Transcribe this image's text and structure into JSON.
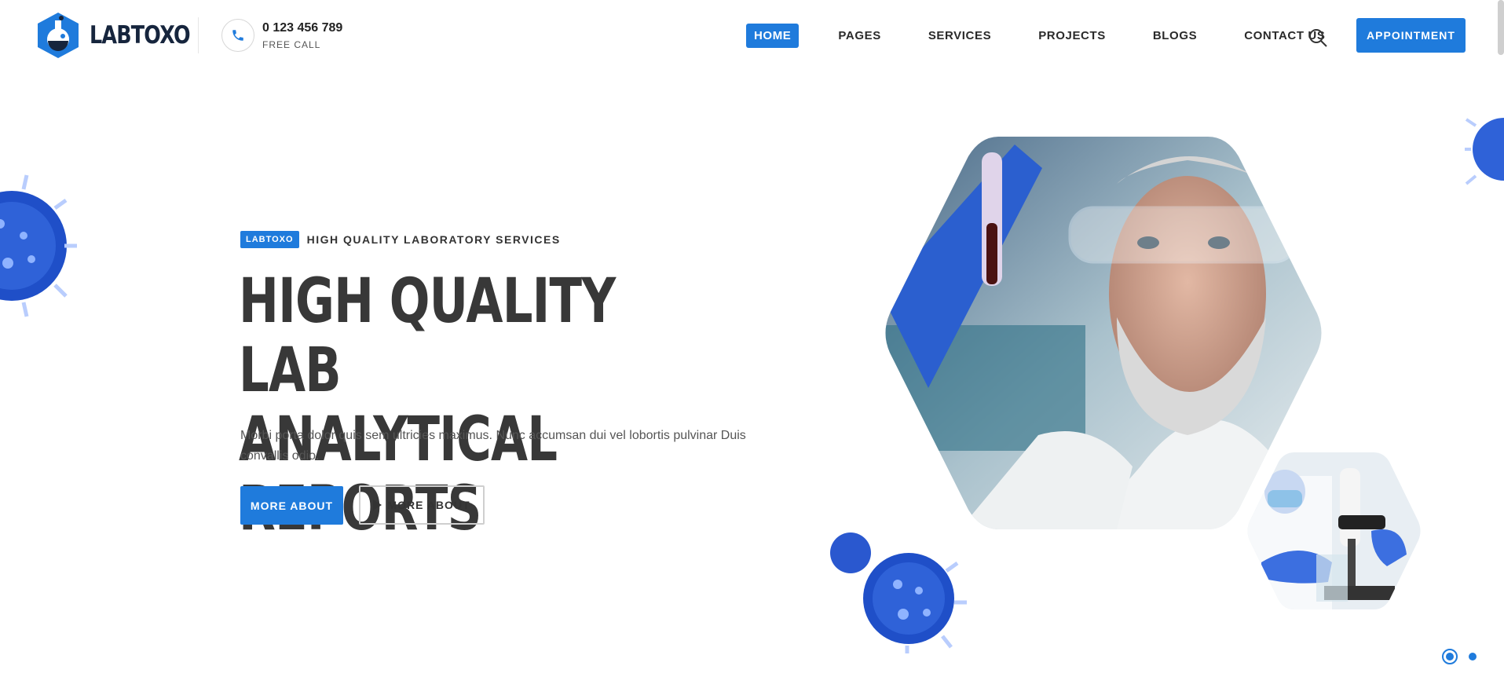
{
  "brand": {
    "name": "LABTOXO",
    "color": "#1f7bdc",
    "dark": "#16253d",
    "icon": "flask-hexagon-logo"
  },
  "contact": {
    "phone": "0 123 456 789",
    "label": "FREE CALL",
    "icon": "phone-icon"
  },
  "nav": {
    "items": [
      {
        "label": "HOME",
        "active": true
      },
      {
        "label": "PAGES",
        "active": false
      },
      {
        "label": "SERVICES",
        "active": false
      },
      {
        "label": "PROJECTS",
        "active": false
      },
      {
        "label": "BLOGS",
        "active": false
      },
      {
        "label": "CONTACT US",
        "active": false
      }
    ],
    "search_icon": "search-icon",
    "cta": "APPOINTMENT"
  },
  "hero": {
    "badge": "LABTOXO",
    "eyebrow": "HIGH QUALITY LABORATORY SERVICES",
    "headline_line1": "HIGH QUALITY LAB",
    "headline_line2": "ANALYTICAL REPORTS",
    "lead": "Morbi porta dolor quis sem ultricies maximus. Nunc accumsan dui vel lobortis pulvinar Duis convallis odio.",
    "primary_button": "MORE ABOUT",
    "secondary_button": "MORE ABOUT",
    "secondary_icon": "play-icon"
  },
  "images": {
    "main": "scientist-in-safety-glasses-photo",
    "secondary": "microscope-researcher-photo",
    "decoration": "virus-illustration"
  },
  "slider": {
    "slides": 2,
    "active": 1
  }
}
